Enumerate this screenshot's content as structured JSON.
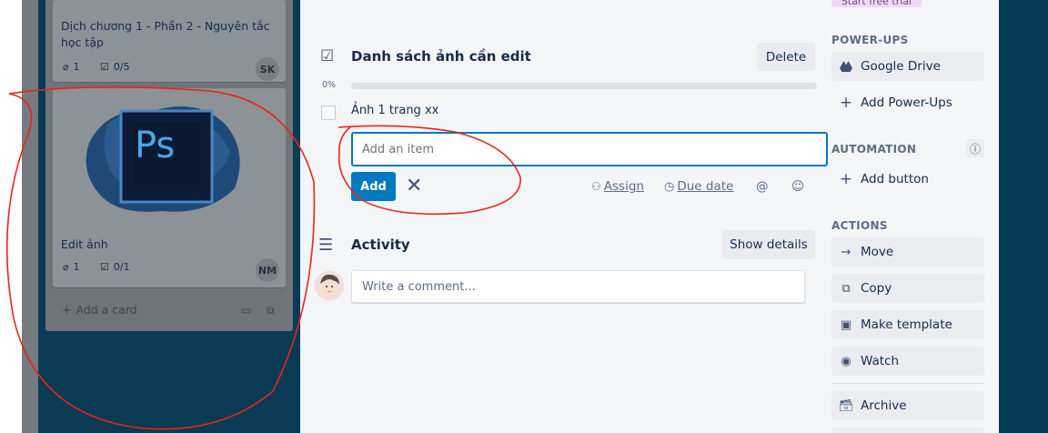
{
  "board": {
    "cards": [
      {
        "title": "Dịch chương 1 - Phần 2 - Nguyên tắc học tập",
        "attachments": "1",
        "checklist": "0/5",
        "member": "SK"
      },
      {
        "title": "Edit ảnh",
        "attachments": "1",
        "checklist": "0/1",
        "member": "NM",
        "cover_logo": "Ps"
      }
    ],
    "add_card_label": "Add a card"
  },
  "checklist": {
    "title": "Danh sách ảnh cần edit",
    "delete_label": "Delete",
    "progress_label": "0%",
    "progress_value": 0,
    "items": [
      {
        "text": "Ảnh 1 trang xx",
        "checked": false
      }
    ],
    "add_input_placeholder": "Add an item",
    "add_button_label": "Add",
    "assign_label": "Assign",
    "due_date_label": "Due date"
  },
  "activity": {
    "title": "Activity",
    "show_details_label": "Show details",
    "comment_placeholder": "Write a comment..."
  },
  "sidebar": {
    "top_pill": "Start free trial",
    "power_ups_heading": "POWER-UPS",
    "google_drive_label": "Google Drive",
    "add_power_ups_label": "Add Power-Ups",
    "automation_heading": "AUTOMATION",
    "add_button_label": "Add button",
    "actions_heading": "ACTIONS",
    "actions": [
      {
        "label": "Move",
        "icon": "arrow-right-icon"
      },
      {
        "label": "Copy",
        "icon": "copy-icon"
      },
      {
        "label": "Make template",
        "icon": "template-icon"
      },
      {
        "label": "Watch",
        "icon": "eye-icon"
      },
      {
        "label": "Archive",
        "icon": "archive-icon"
      }
    ]
  },
  "colors": {
    "accent": "#0079bf",
    "annotation": "#e8241c"
  }
}
